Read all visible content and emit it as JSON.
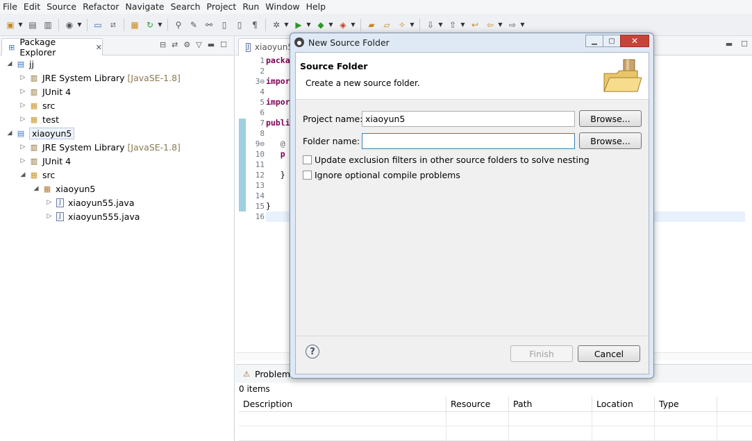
{
  "menu": [
    "File",
    "Edit",
    "Source",
    "Refactor",
    "Navigate",
    "Search",
    "Project",
    "Run",
    "Window",
    "Help"
  ],
  "package_explorer": {
    "tab_label": "Package Explorer",
    "tree": [
      {
        "label": "jj",
        "depth": 0,
        "kind": "project",
        "expanded": true
      },
      {
        "label": "JRE System Library",
        "suffix": "[JavaSE-1.8]",
        "depth": 1,
        "kind": "library"
      },
      {
        "label": "JUnit 4",
        "depth": 1,
        "kind": "library"
      },
      {
        "label": "src",
        "depth": 1,
        "kind": "folder"
      },
      {
        "label": "test",
        "depth": 1,
        "kind": "folder"
      },
      {
        "label": "xiaoyun5",
        "depth": 0,
        "kind": "project",
        "expanded": true,
        "selected": true
      },
      {
        "label": "JRE System Library",
        "suffix": "[JavaSE-1.8]",
        "depth": 1,
        "kind": "library"
      },
      {
        "label": "JUnit 4",
        "depth": 1,
        "kind": "library"
      },
      {
        "label": "src",
        "depth": 1,
        "kind": "folder",
        "expanded": true
      },
      {
        "label": "xiaoyun5",
        "depth": 2,
        "kind": "package",
        "expanded": true
      },
      {
        "label": "xiaoyun55.java",
        "depth": 3,
        "kind": "java"
      },
      {
        "label": "xiaoyun555.java",
        "depth": 3,
        "kind": "java"
      }
    ]
  },
  "editor": {
    "tab_label": "xiaoyun5",
    "line_numbers": [
      "1",
      "2",
      "3⊖",
      "4",
      "5",
      "6",
      "7",
      "8",
      "9⊖",
      "10",
      "11",
      "12",
      "13",
      "14",
      "15",
      "16"
    ],
    "code_lines": [
      {
        "text": "packa",
        "style": "kw"
      },
      {
        "text": "",
        "style": "plain"
      },
      {
        "text": "impor",
        "style": "kw"
      },
      {
        "text": "",
        "style": "plain"
      },
      {
        "text": "impor",
        "style": "kw"
      },
      {
        "text": "",
        "style": "plain"
      },
      {
        "text": "publi",
        "style": "kw"
      },
      {
        "text": "",
        "style": "plain"
      },
      {
        "text": "   @",
        "style": "ann"
      },
      {
        "text": "   p",
        "style": "kw"
      },
      {
        "text": "",
        "style": "plain"
      },
      {
        "text": "   }",
        "style": "plain"
      },
      {
        "text": "",
        "style": "plain"
      },
      {
        "text": "",
        "style": "plain"
      },
      {
        "text": "}",
        "style": "plain"
      },
      {
        "text": "",
        "style": "cur"
      }
    ]
  },
  "problems": {
    "tab_label": "Problems",
    "count": "0 items",
    "columns": [
      "Description",
      "Resource",
      "Path",
      "Location",
      "Type"
    ]
  },
  "dialog": {
    "title": "New Source Folder",
    "heading": "Source Folder",
    "description": "Create a new source folder.",
    "project_label": "Project name:",
    "project_value": "xiaoyun5",
    "folder_label": "Folder name:",
    "folder_value": "",
    "browse_label": "Browse...",
    "checkbox_exclusion": "Update exclusion filters in other source folders to solve nesting",
    "checkbox_ignore": "Ignore optional compile problems",
    "finish_label": "Finish",
    "cancel_label": "Cancel",
    "help_symbol": "?"
  }
}
